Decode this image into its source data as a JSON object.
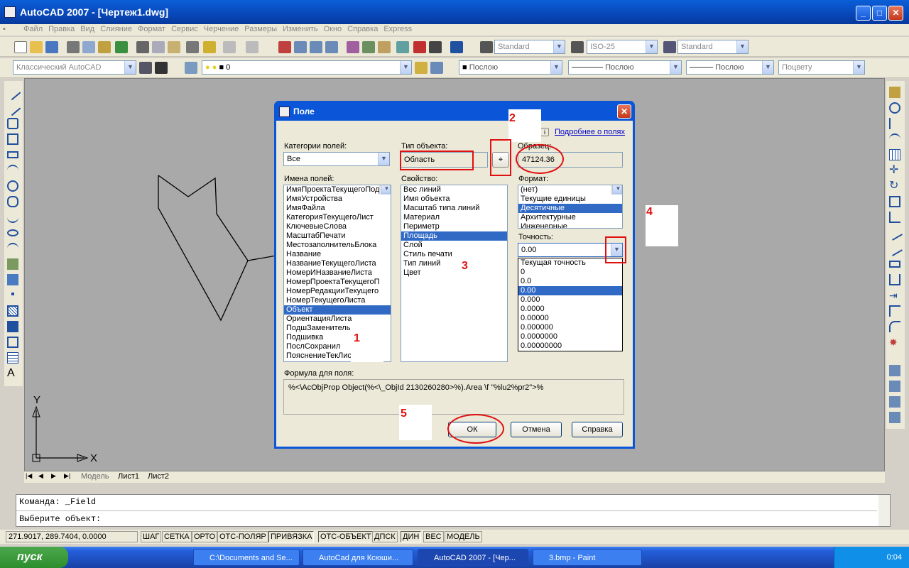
{
  "window": {
    "title": "AutoCAD 2007 - [Чертеж1.dwg]"
  },
  "menu": [
    "Файл",
    "Правка",
    "Вид",
    "Слияние",
    "Формат",
    "Сервис",
    "Черчение",
    "Размеры",
    "Изменить",
    "Окно",
    "Справка",
    "Express"
  ],
  "toolbar": {
    "text_style": "Standard",
    "dim_style": "ISO-25",
    "table_style": "Standard",
    "workspace": "Классический AutoCAD",
    "layer": "0",
    "color": "Послою",
    "linetype": "Послою",
    "lineweight": "Послою",
    "plotstyle": "Поцвету"
  },
  "tabs": {
    "model": "Модель",
    "layout1": "Лист1",
    "layout2": "Лист2"
  },
  "command": {
    "line1": "Команда: _Field",
    "line2": "Выберите объект:"
  },
  "status": {
    "coords": "271.9017, 289.7404, 0.0000",
    "buttons": [
      "ШАГ",
      "СЕТКА",
      "ОРТО",
      "ОТС-ПОЛЯР",
      "ПРИВЯЗКА",
      "ОТС-ОБЪЕКТ",
      "ДПСК",
      "ДИН",
      "ВЕС",
      "МОДЕЛЬ"
    ]
  },
  "taskbar": {
    "start": "пуск",
    "tasks": [
      "C:\\Documents and Se...",
      "AutoCad для Ксюши...",
      "AutoCAD 2007 - [Чер...",
      "3.bmp - Paint"
    ],
    "clock": "0:04"
  },
  "axes": {
    "x": "X",
    "y": "Y"
  },
  "dialog": {
    "title": "Поле",
    "help_link": "Подробнее о полях",
    "categories_label": "Категории полей:",
    "categories_value": "Все",
    "field_names_label": "Имена полей:",
    "field_names": [
      "ИмяПроектаТекущегоПод",
      "ИмяУстройства",
      "ИмяФайла",
      "КатегорияТекущегоЛист",
      "КлючевыеСлова",
      "МасштабПечати",
      "МестозаполнительБлока",
      "Название",
      "НазваниеТекущегоЛиста",
      "НомерИНазваниеЛиста",
      "НомерПроектаТекущегоП",
      "НомерРедакцииТекущего",
      "НомерТекущегоЛиста",
      "Объект",
      "ОриентацияЛиста",
      "ПодшЗаменитель",
      "Подшивка",
      "ПослСохранил",
      "ПояснениеТекЛис"
    ],
    "field_selected": "Объект",
    "object_type_label": "Тип объекта:",
    "object_type_value": "Область",
    "sample_label": "Образец:",
    "sample_value": "47124.36",
    "property_label": "Свойство:",
    "properties": [
      "Вес линий",
      "Имя объекта",
      "Масштаб типа линий",
      "Материал",
      "Периметр",
      "Площадь",
      "Слой",
      "Стиль печати",
      "Тип линий",
      "Цвет"
    ],
    "property_selected": "Площадь",
    "format_label": "Формат:",
    "formats": [
      "(нет)",
      "Текущие единицы",
      "Десятичные",
      "Архитектурные",
      "Инженерные"
    ],
    "format_selected": "Десятичные",
    "precision_label": "Точность:",
    "precision_value": "0.00",
    "precision_options": [
      "Текущая точность",
      "0",
      "0.0",
      "0.00",
      "0.000",
      "0.0000",
      "0.00000",
      "0.000000",
      "0.0000000",
      "0.00000000"
    ],
    "formula_label": "Формула для поля:",
    "formula": "%<\\AcObjProp Object(%<\\_ObjId 2130260280>%).Area \\f \"%lu2%pr2\">%",
    "ok": "ОК",
    "cancel": "Отмена",
    "help": "Справка"
  },
  "annotations": [
    "1",
    "2",
    "3",
    "4",
    "5"
  ],
  "colors": {
    "selection": "#316ac5",
    "annotation": "#e01010",
    "titlebar": "#0a55d8"
  }
}
